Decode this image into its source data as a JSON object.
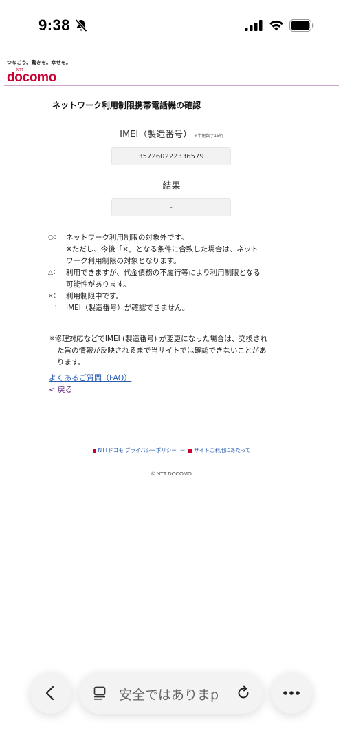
{
  "status_bar": {
    "time": "9:38"
  },
  "header": {
    "tagline": "つなごう。驚きを。幸せを。",
    "brand_small": "NTT",
    "logo": "docomo",
    "accent_color": "#cc0033"
  },
  "page": {
    "title": "ネットワーク利用制限携帯電話機の確認",
    "imei_label": "IMEI（製造番号）",
    "imei_note": "※半角数字15桁",
    "imei_value": "357260222336579",
    "result_label": "結果",
    "result_value": "-"
  },
  "legend": {
    "items": [
      {
        "symbol": "○：",
        "text": "ネットワーク利用制限の対象外です。"
      },
      {
        "symbol": "",
        "text": "※ただし、今後「×」となる条件に合致した場合は、ネット"
      },
      {
        "symbol": "",
        "text": "ワーク利用制限の対象となります。"
      },
      {
        "symbol": "△：",
        "text": "利用できますが、代金債務の不履行等により利用制限となる"
      },
      {
        "symbol": "",
        "text": "可能性があります。"
      },
      {
        "symbol": "×：",
        "text": "利用制限中です。"
      },
      {
        "symbol": "－：",
        "text": "IMEI（製造番号）が確認できません。"
      }
    ]
  },
  "note": {
    "asterisk": "※",
    "line1": "修理対応などでIMEI (製造番号) が変更になった場合は、交換され",
    "line2": "た旨の情報が反映されるまで当サイトでは確認できないことがあ",
    "line3": "ります。"
  },
  "links": {
    "faq": "よくあるご質問（FAQ）",
    "back": "< 戻る"
  },
  "footer": {
    "privacy": "NTTドコモ プライバシーポリシー",
    "terms": "サイトご利用にあたって",
    "separator": "ー",
    "copyright": "© NTT DOCOMO"
  },
  "browser": {
    "url_text": "安全ではありま",
    "url_tail": "p",
    "icons": [
      "back-chevron-icon",
      "reader-icon",
      "reload-icon",
      "more-icon"
    ]
  }
}
